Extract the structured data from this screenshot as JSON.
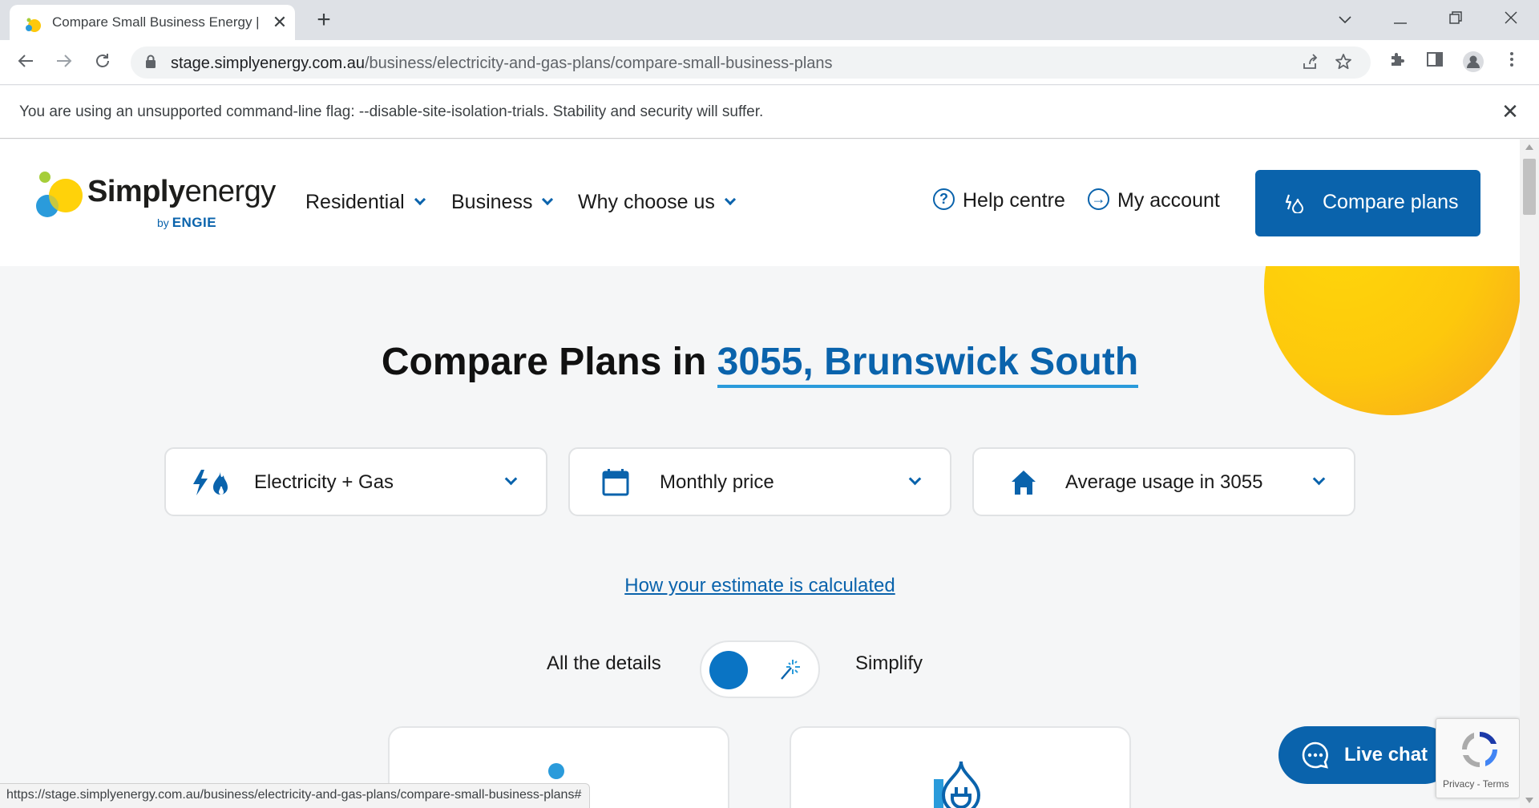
{
  "browser": {
    "tab_title": "Compare Small Business Energy |",
    "url_host": "stage.simplyenergy.com.au",
    "url_path": "/business/electricity-and-gas-plans/compare-small-business-plans",
    "infobar_message": "You are using an unsupported command-line flag: --disable-site-isolation-trials. Stability and security will suffer.",
    "status_url": "https://stage.simplyenergy.com.au/business/electricity-and-gas-plans/compare-small-business-plans#"
  },
  "header": {
    "logo_simply": "Simply",
    "logo_energy": "energy",
    "logo_by": "by",
    "logo_engie": "ENGIE",
    "nav": {
      "residential": "Residential",
      "business": "Business",
      "why": "Why choose us"
    },
    "help": "Help centre",
    "account": "My account",
    "cta": "Compare plans"
  },
  "main": {
    "heading_prefix": "Compare Plans in ",
    "heading_location": "3055, Brunswick South",
    "filters": {
      "fuel": "Electricity + Gas",
      "period": "Monthly price",
      "usage": "Average usage in 3055"
    },
    "estimate_link": "How your estimate is calculated",
    "toggle_left": "All the details",
    "toggle_right": "Simplify"
  },
  "widgets": {
    "live_chat": "Live chat",
    "recaptcha_links": "Privacy - Terms"
  },
  "colors": {
    "brand_blue": "#0a63ac",
    "sun_yellow": "#fdc80c",
    "page_bg": "#f5f6f7"
  }
}
